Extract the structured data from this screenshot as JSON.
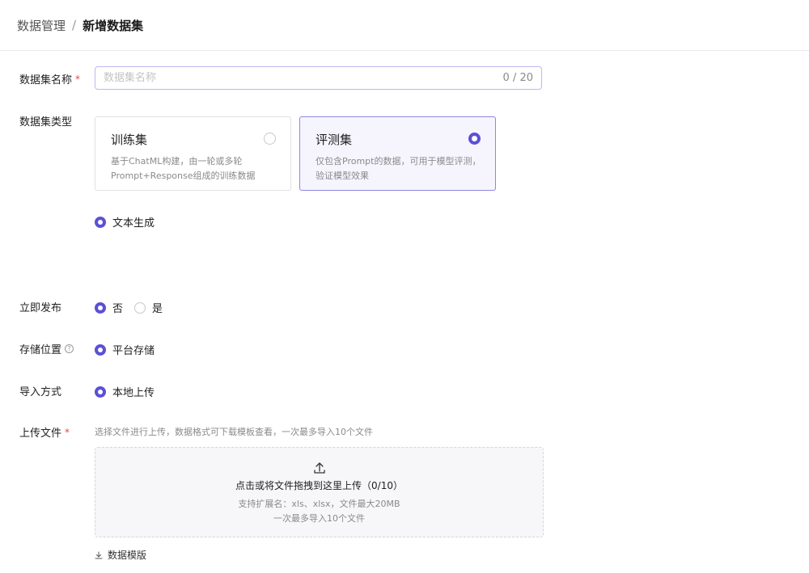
{
  "breadcrumb": {
    "parent": "数据管理",
    "separator": "/",
    "current": "新增数据集"
  },
  "form": {
    "name": {
      "label": "数据集名称",
      "required_mark": "*",
      "placeholder": "数据集名称",
      "value": "",
      "counter": "0 / 20"
    },
    "type": {
      "label": "数据集类型",
      "cards": [
        {
          "title": "训练集",
          "desc": "基于ChatML构建，由一轮或多轮Prompt+Response组成的训练数据",
          "selected": false
        },
        {
          "title": "评测集",
          "desc": "仅包含Prompt的数据，可用于模型评测，验证模型效果",
          "selected": true
        }
      ],
      "subtype": {
        "label": "文本生成",
        "selected": true
      }
    },
    "publish": {
      "label": "立即发布",
      "options": [
        {
          "label": "否",
          "selected": true
        },
        {
          "label": "是",
          "selected": false
        }
      ]
    },
    "storage": {
      "label": "存储位置",
      "help_icon": "?",
      "options": [
        {
          "label": "平台存储",
          "selected": true
        }
      ]
    },
    "import_method": {
      "label": "导入方式",
      "options": [
        {
          "label": "本地上传",
          "selected": true
        }
      ]
    },
    "upload": {
      "label": "上传文件",
      "required_mark": "*",
      "hint": "选择文件进行上传，数据格式可下载模板查看，一次最多导入10个文件",
      "dropzone_main": "点击或将文件拖拽到这里上传（0/10）",
      "dropzone_sub1": "支持扩展名：xls、xlsx，文件最大20MB",
      "dropzone_sub2": "一次最多导入10个文件",
      "template_link": "数据模版"
    }
  },
  "colors": {
    "accent": "#5b50d6",
    "required": "#e5484d",
    "selected_card_bg": "#f6f5fe"
  },
  "icons": {
    "upload": "upload-icon",
    "download": "download-icon",
    "help": "question-circle-icon"
  }
}
